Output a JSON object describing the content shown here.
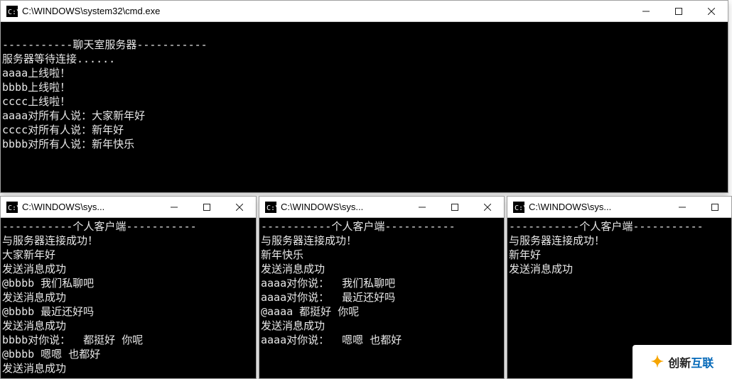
{
  "windows": {
    "server": {
      "title": "C:\\WINDOWS\\system32\\cmd.exe",
      "lines": [
        "",
        "-----------聊天室服务器-----------",
        "服务器等待连接......",
        "aaaa上线啦！",
        "bbbb上线啦！",
        "cccc上线啦！",
        "aaaa对所有人说：大家新年好",
        "cccc对所有人说：新年好",
        "bbbb对所有人说：新年快乐"
      ]
    },
    "client1": {
      "title": "C:\\WINDOWS\\sys...",
      "lines": [
        "-----------个人客户端-----------",
        "与服务器连接成功！",
        "大家新年好",
        "发送消息成功",
        "@bbbb 我们私聊吧",
        "发送消息成功",
        "@bbbb 最近还好吗",
        "发送消息成功",
        "bbbb对你说：  都挺好 你呢",
        "@bbbb 嗯嗯 也都好",
        "发送消息成功"
      ]
    },
    "client2": {
      "title": "C:\\WINDOWS\\sys...",
      "lines": [
        "-----------个人客户端-----------",
        "与服务器连接成功！",
        "新年快乐",
        "发送消息成功",
        "aaaa对你说：  我们私聊吧",
        "aaaa对你说：  最近还好吗",
        "@aaaa 都挺好 你呢",
        "发送消息成功",
        "aaaa对你说：  嗯嗯 也都好"
      ]
    },
    "client3": {
      "title": "C:\\WINDOWS\\sys...",
      "lines": [
        "-----------个人客户端-----------",
        "与服务器连接成功！",
        "新年好",
        "发送消息成功"
      ]
    }
  },
  "logo": {
    "brand_a": "创新",
    "brand_b": "互联"
  }
}
